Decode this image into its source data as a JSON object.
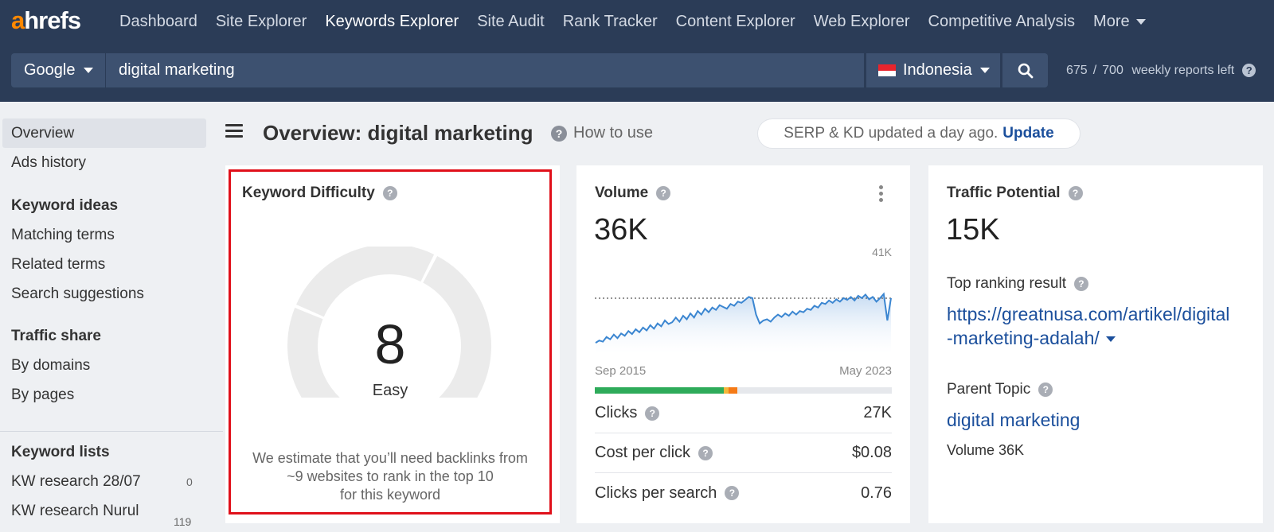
{
  "brand": {
    "logo_first": "a",
    "logo_rest": "hrefs",
    "accent": "#ff8800"
  },
  "nav": {
    "items": [
      "Dashboard",
      "Site Explorer",
      "Keywords Explorer",
      "Site Audit",
      "Rank Tracker",
      "Content Explorer",
      "Web Explorer",
      "Competitive Analysis"
    ],
    "more": "More",
    "active": "Keywords Explorer"
  },
  "search": {
    "engine": "Google",
    "keyword": "digital marketing",
    "country": "Indonesia",
    "reports_used": "675",
    "reports_sep": "/",
    "reports_total": "700",
    "reports_label": "weekly reports left",
    "help": "?"
  },
  "sidebar": {
    "overview": "Overview",
    "ads_history": "Ads history",
    "keyword_ideas_head": "Keyword ideas",
    "matching_terms": "Matching terms",
    "related_terms": "Related terms",
    "search_suggestions": "Search suggestions",
    "traffic_share_head": "Traffic share",
    "by_domains": "By domains",
    "by_pages": "By pages",
    "keyword_lists_head": "Keyword lists",
    "list1": {
      "name": "KW research 28/07",
      "count": "0"
    },
    "list2": {
      "name": "KW research Nurul",
      "count": "119"
    }
  },
  "header": {
    "title": "Overview: digital marketing",
    "how_to_use": "How to use",
    "serp_text": "SERP & KD updated a day ago.",
    "update_label": "Update"
  },
  "kd": {
    "title": "Keyword Difficulty",
    "value": "8",
    "label": "Easy",
    "score": 8,
    "desc_line1": "We estimate that you’ll need backlinks from",
    "desc_line2": "~9 websites to rank in the top 10",
    "desc_line3": "for this keyword",
    "fill_color": "#0d9f4f"
  },
  "volume": {
    "title": "Volume",
    "value": "36K",
    "chart_max_label": "41K",
    "x_start": "Sep 2015",
    "x_end": "May 2023",
    "clicks_label": "Clicks",
    "clicks_value": "27K",
    "cpc_label": "Cost per click",
    "cpc_value": "$0.08",
    "cps_label": "Clicks per search",
    "cps_value": "0.76",
    "trend": [
      0.12,
      0.16,
      0.14,
      0.22,
      0.18,
      0.26,
      0.2,
      0.28,
      0.24,
      0.32,
      0.27,
      0.35,
      0.3,
      0.38,
      0.33,
      0.42,
      0.36,
      0.45,
      0.4,
      0.5,
      0.44,
      0.47,
      0.55,
      0.48,
      0.58,
      0.52,
      0.62,
      0.55,
      0.66,
      0.6,
      0.7,
      0.64,
      0.72,
      0.68,
      0.76,
      0.73,
      0.7,
      0.78,
      0.75,
      0.82,
      0.8,
      0.85,
      0.9,
      0.88,
      0.6,
      0.45,
      0.5,
      0.52,
      0.48,
      0.55,
      0.6,
      0.56,
      0.62,
      0.58,
      0.65,
      0.6,
      0.66,
      0.64,
      0.7,
      0.68,
      0.75,
      0.72,
      0.8,
      0.78,
      0.84,
      0.8,
      0.86,
      0.82,
      0.88,
      0.85,
      0.9,
      0.84,
      0.92,
      0.88,
      0.94,
      0.86,
      0.9,
      0.82,
      0.88,
      0.95,
      0.5,
      0.88
    ],
    "bar": {
      "green": 0.435,
      "yellow": 0.015,
      "orange": 0.03
    }
  },
  "traffic": {
    "title": "Traffic Potential",
    "value": "15K",
    "top_result_label": "Top ranking result",
    "top_result_url_1": "https://greatnusa.com/artikel/digital",
    "top_result_url_2": "-marketing-adalah/",
    "parent_topic_label": "Parent Topic",
    "parent_topic": "digital marketing",
    "parent_volume": "Volume 36K"
  }
}
